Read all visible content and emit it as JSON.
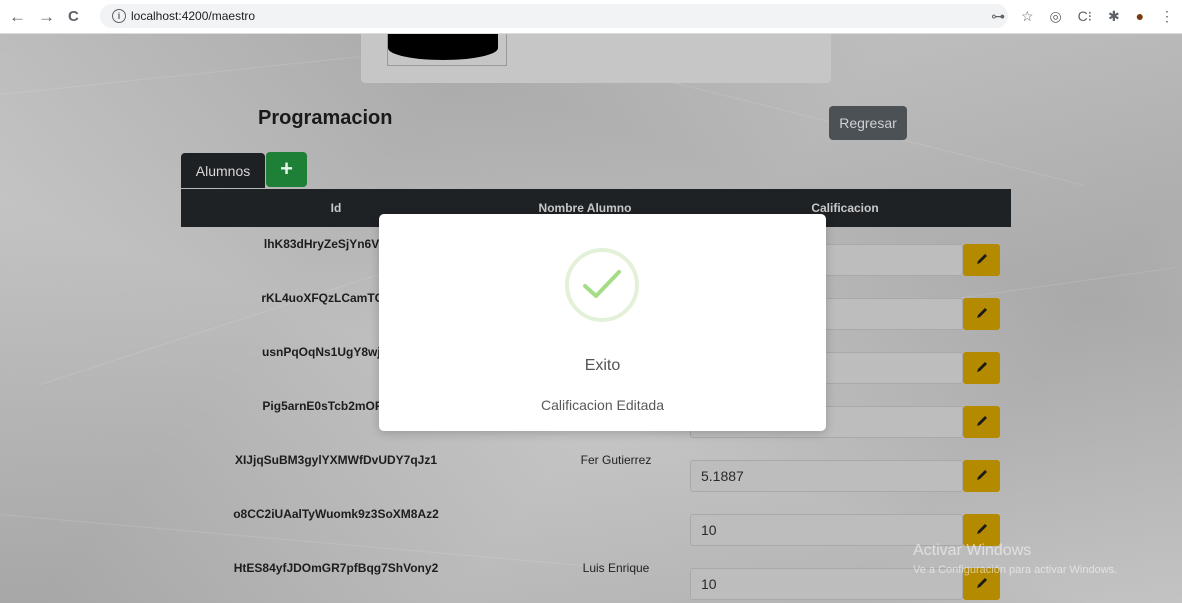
{
  "browser": {
    "url": "localhost:4200/maestro",
    "back_icon": "←",
    "forward_icon": "→",
    "reload_icon": "C",
    "ext_icons": [
      "⊶",
      "☆",
      "◎",
      "C⁝",
      "✱",
      "●",
      "⋮"
    ]
  },
  "header": {
    "title": "Programacion",
    "back_button": "Regresar"
  },
  "tabs": {
    "alumnos": "Alumnos",
    "add": "+"
  },
  "table": {
    "columns": [
      "Id",
      "Nombre Alumno",
      "Calificacion"
    ],
    "rows": [
      {
        "id": "lhK83dHryZeSjYn6Vu4yH",
        "name": "",
        "grade": ""
      },
      {
        "id": "rKL4uoXFQzLCamTGLWU",
        "name": "",
        "grade": ""
      },
      {
        "id": "usnPqOqNs1UgY8wjtNBP",
        "name": "",
        "grade": ""
      },
      {
        "id": "Pig5arnE0sTcb2mOFcn1x",
        "name": "",
        "grade": ""
      },
      {
        "id": "XIJjqSuBM3gylYXMWfDvUDY7qJz1",
        "name": "Fer Gutierrez",
        "grade": "5.1887"
      },
      {
        "id": "o8CC2iUAalTyWuomk9z3SoXM8Az2",
        "name": "",
        "grade": "10"
      },
      {
        "id": "HtES84yfJDOmGR7pfBqg7ShVony2",
        "name": "Luis Enrique",
        "grade": "10"
      }
    ]
  },
  "watermark": {
    "line1": "Activar Windows",
    "line2": "Ve a Configuración para activar Windows."
  },
  "modal": {
    "title": "Exito",
    "text": "Calificacion Editada"
  },
  "colors": {
    "success": "#a5dc86",
    "edit_button": "#b38a00",
    "header_dark": "#1f2225",
    "add_button": "#1e7f36"
  }
}
